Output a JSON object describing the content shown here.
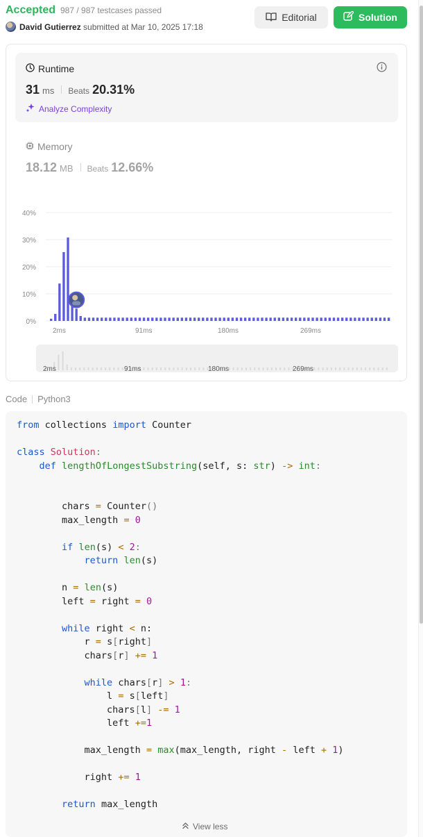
{
  "header": {
    "status": "Accepted",
    "testcases": "987 / 987 testcases passed",
    "user": "David Gutierrez",
    "submitted": "submitted at Mar 10, 2025 17:18",
    "editorial_label": "Editorial",
    "solution_label": "Solution"
  },
  "runtime": {
    "title": "Runtime",
    "value": "31",
    "unit": "ms",
    "beats_label": "Beats",
    "beats_value": "20.31%",
    "analyze_label": "Analyze Complexity"
  },
  "memory": {
    "title": "Memory",
    "value": "18.12",
    "unit": "MB",
    "beats_label": "Beats",
    "beats_value": "12.66%"
  },
  "chart_data": {
    "type": "bar",
    "y_ticks": [
      "40%",
      "30%",
      "20%",
      "10%",
      "0%"
    ],
    "ylim": [
      0,
      40
    ],
    "x_ticks": [
      "2ms",
      "91ms",
      "180ms",
      "269ms"
    ],
    "values": [
      0.8,
      2.6,
      13.8,
      25.4,
      30.8,
      9.5,
      4.5,
      1.8,
      1.2,
      1.2,
      1.2,
      1.2,
      1.2,
      1.2,
      1.2,
      1.2,
      1.2,
      1.2,
      1.2,
      1.2,
      1.2,
      1.2,
      1.2,
      1.2,
      1.2,
      1.2,
      1.2,
      1.2,
      1.2,
      1.2,
      1.2,
      1.2,
      1.2,
      1.2,
      1.2,
      1.2,
      1.2,
      1.2,
      1.2,
      1.2,
      1.2,
      1.2,
      1.2,
      1.2,
      1.2,
      1.2,
      1.2,
      1.2,
      1.2,
      1.2,
      1.2,
      1.2,
      1.2,
      1.2,
      1.2,
      1.2,
      1.2,
      1.2,
      1.2,
      1.2,
      1.2,
      1.2,
      1.2,
      1.2,
      1.2,
      1.2,
      1.2,
      1.2,
      1.2,
      1.2,
      1.2,
      1.2,
      1.2,
      1.2,
      1.2,
      1.2,
      1.2,
      1.2,
      1.2,
      1.2,
      1.2
    ],
    "bar_color": "#5b5bdc",
    "user_bar_index": 6,
    "navigator_ticks": [
      "2ms",
      "91ms",
      "180ms",
      "269ms"
    ]
  },
  "code": {
    "label": "Code",
    "language": "Python3",
    "view_less": "View less",
    "lines": [
      [
        [
          "from",
          "kw"
        ],
        [
          " collections ",
          ""
        ],
        [
          "import",
          "kw"
        ],
        [
          " Counter",
          ""
        ]
      ],
      [],
      [
        [
          "class",
          "kw"
        ],
        [
          " ",
          ""
        ],
        [
          "Solution",
          "cls"
        ],
        [
          ":",
          "pu"
        ]
      ],
      [
        [
          "    ",
          ""
        ],
        [
          "def",
          "kw"
        ],
        [
          " ",
          ""
        ],
        [
          "lengthOfLongestSubstring",
          "fn"
        ],
        [
          "(self, s: ",
          ""
        ],
        [
          "str",
          "ty"
        ],
        [
          ") ",
          ""
        ],
        [
          "->",
          "op"
        ],
        [
          " ",
          ""
        ],
        [
          "int",
          "ty"
        ],
        [
          ":",
          "pu"
        ]
      ],
      [],
      [],
      [
        [
          "        chars ",
          ""
        ],
        [
          "=",
          "op"
        ],
        [
          " Counter",
          ""
        ],
        [
          "()",
          "pu"
        ]
      ],
      [
        [
          "        max_length ",
          ""
        ],
        [
          "=",
          "op"
        ],
        [
          " ",
          ""
        ],
        [
          "0",
          "num"
        ]
      ],
      [],
      [
        [
          "        ",
          ""
        ],
        [
          "if",
          "kw"
        ],
        [
          " ",
          ""
        ],
        [
          "len",
          "fn"
        ],
        [
          "(s) ",
          ""
        ],
        [
          "<",
          "op"
        ],
        [
          " ",
          ""
        ],
        [
          "2",
          "num"
        ],
        [
          ":",
          "pu"
        ]
      ],
      [
        [
          "            ",
          ""
        ],
        [
          "return",
          "kw"
        ],
        [
          " ",
          ""
        ],
        [
          "len",
          "fn"
        ],
        [
          "(s)",
          ""
        ]
      ],
      [],
      [
        [
          "        n ",
          ""
        ],
        [
          "=",
          "op"
        ],
        [
          " ",
          ""
        ],
        [
          "len",
          "fn"
        ],
        [
          "(s)",
          ""
        ]
      ],
      [
        [
          "        left ",
          ""
        ],
        [
          "=",
          "op"
        ],
        [
          " right ",
          ""
        ],
        [
          "=",
          "op"
        ],
        [
          " ",
          ""
        ],
        [
          "0",
          "num"
        ]
      ],
      [],
      [
        [
          "        ",
          ""
        ],
        [
          "while",
          "kw"
        ],
        [
          " right ",
          ""
        ],
        [
          "<",
          "op"
        ],
        [
          " n:",
          ""
        ]
      ],
      [
        [
          "            r ",
          ""
        ],
        [
          "=",
          "op"
        ],
        [
          " s",
          ""
        ],
        [
          "[",
          "pu"
        ],
        [
          "right",
          ""
        ],
        [
          "]",
          "pu"
        ]
      ],
      [
        [
          "            chars",
          ""
        ],
        [
          "[",
          "pu"
        ],
        [
          "r",
          ""
        ],
        [
          "]",
          "pu"
        ],
        [
          " ",
          ""
        ],
        [
          "+=",
          "op"
        ],
        [
          " ",
          ""
        ],
        [
          "1",
          "num"
        ]
      ],
      [],
      [
        [
          "            ",
          ""
        ],
        [
          "while",
          "kw"
        ],
        [
          " chars",
          ""
        ],
        [
          "[",
          "pu"
        ],
        [
          "r",
          ""
        ],
        [
          "]",
          "pu"
        ],
        [
          " ",
          ""
        ],
        [
          ">",
          "op"
        ],
        [
          " ",
          ""
        ],
        [
          "1",
          "num"
        ],
        [
          ":",
          "pu"
        ]
      ],
      [
        [
          "                l ",
          ""
        ],
        [
          "=",
          "op"
        ],
        [
          " s",
          ""
        ],
        [
          "[",
          "pu"
        ],
        [
          "left",
          ""
        ],
        [
          "]",
          "pu"
        ]
      ],
      [
        [
          "                chars",
          ""
        ],
        [
          "[",
          "pu"
        ],
        [
          "l",
          ""
        ],
        [
          "]",
          "pu"
        ],
        [
          " ",
          ""
        ],
        [
          "-=",
          "op"
        ],
        [
          " ",
          ""
        ],
        [
          "1",
          "num"
        ]
      ],
      [
        [
          "                left ",
          ""
        ],
        [
          "+=",
          "op"
        ],
        [
          "1",
          "num"
        ]
      ],
      [],
      [
        [
          "            max_length ",
          ""
        ],
        [
          "=",
          "op"
        ],
        [
          " ",
          ""
        ],
        [
          "max",
          "fn"
        ],
        [
          "(max_length, right ",
          ""
        ],
        [
          "-",
          "op"
        ],
        [
          " left ",
          ""
        ],
        [
          "+",
          "op"
        ],
        [
          " ",
          ""
        ],
        [
          "1",
          "num"
        ],
        [
          ")",
          ""
        ]
      ],
      [],
      [
        [
          "            right ",
          ""
        ],
        [
          "+=",
          "op"
        ],
        [
          " ",
          ""
        ],
        [
          "1",
          "num"
        ]
      ],
      [],
      [
        [
          "        ",
          ""
        ],
        [
          "return",
          "kw"
        ],
        [
          " max_length",
          ""
        ]
      ]
    ]
  }
}
